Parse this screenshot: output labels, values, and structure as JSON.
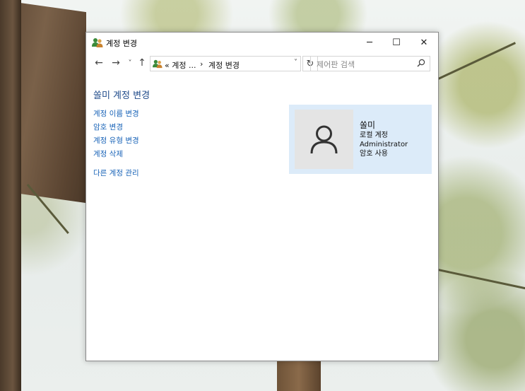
{
  "window": {
    "title": "계정 변경",
    "controls": {
      "minimize": "─",
      "maximize": "☐",
      "close": "✕"
    }
  },
  "nav": {
    "back": "←",
    "forward": "→",
    "recent": "˅",
    "up": "↑",
    "breadcrumb": [
      "« 계정 ...",
      "›",
      "계정 변경"
    ],
    "dropdown": "˅",
    "refresh": "↻"
  },
  "search": {
    "placeholder": "제어판 검색"
  },
  "main": {
    "heading": "쏠미 계정 변경",
    "links": [
      "계정 이름 변경",
      "암호 변경",
      "계정 유형 변경",
      "계정 삭제"
    ],
    "extra_link": "다른 계정 관리"
  },
  "account": {
    "name": "쏠미",
    "type": "로컬 계정",
    "role": "Administrator",
    "password": "암호 사용"
  },
  "colors": {
    "link": "#1a64b8",
    "heading": "#1e4a8a",
    "card_background": "#dcebf9",
    "avatar_background": "#e4e4e4"
  },
  "icons": {
    "app": "users-icon",
    "search": "search-icon",
    "avatar": "user-silhouette-icon"
  }
}
